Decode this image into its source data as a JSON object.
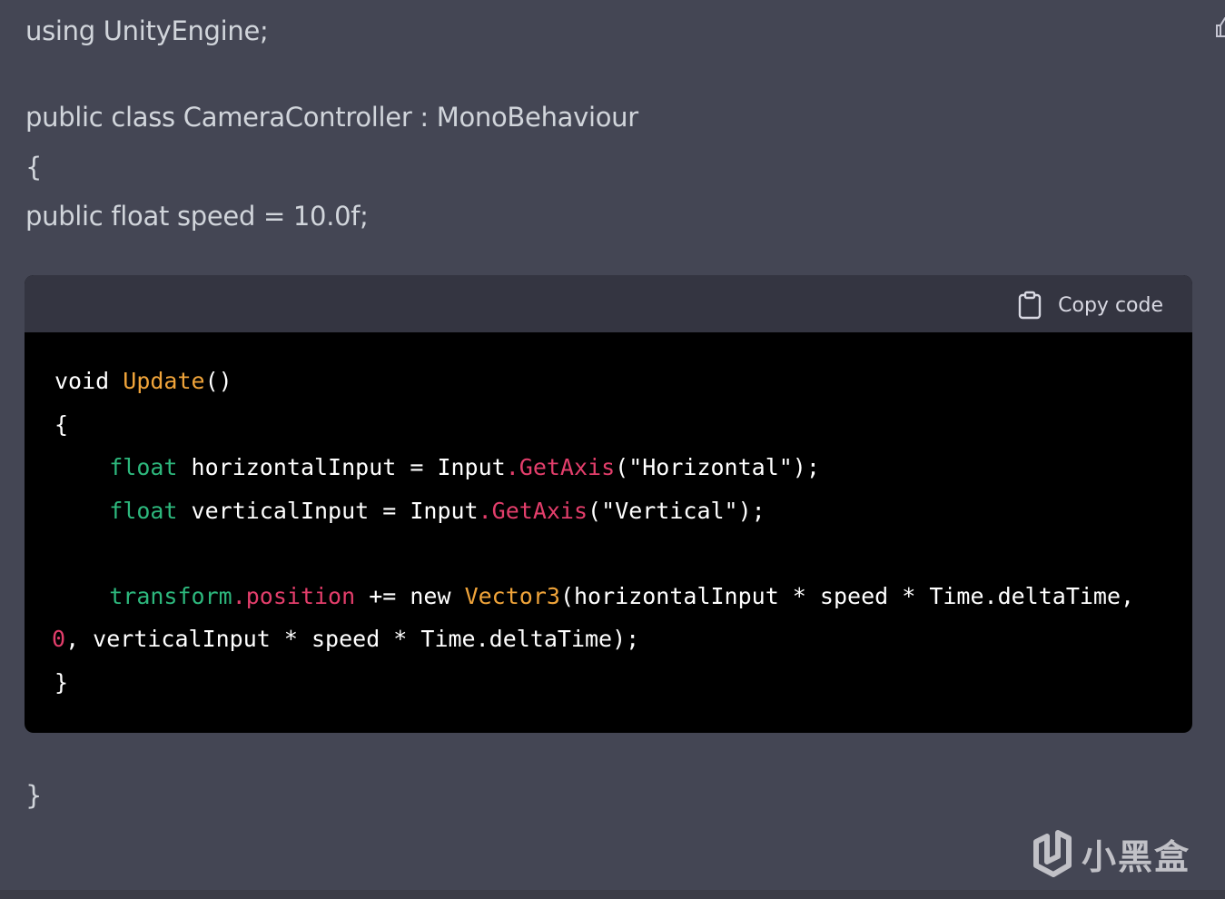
{
  "prose": {
    "line1": "using UnityEngine;",
    "line2": "public class CameraController : MonoBehaviour",
    "line3": "{",
    "line4": "public float speed = 10.0f;",
    "line5": "}"
  },
  "code_block": {
    "copy_label": "Copy code",
    "lines": {
      "l1": {
        "a": "void ",
        "b": "Update",
        "c": "()"
      },
      "l2": {
        "a": "{"
      },
      "l3": {
        "a": "    ",
        "b": "float",
        "c": " horizontalInput = Input",
        "d": ".GetAxis",
        "e": "(\"Horizontal\");"
      },
      "l4": {
        "a": "    ",
        "b": "float",
        "c": " verticalInput = Input",
        "d": ".GetAxis",
        "e": "(\"Vertical\");"
      },
      "l5": {
        "a": "    ",
        "b": "transform",
        "c": ".position",
        "d": " += new ",
        "e": "Vector3",
        "f": "(horizontalInput * speed * Time.deltaTime,"
      },
      "l6": {
        "a": "0",
        "b": ", verticalInput * speed * Time.deltaTime);"
      },
      "l7": {
        "a": "}"
      }
    }
  },
  "watermark": {
    "text": "小黑盒"
  },
  "colors": {
    "background": "#444654",
    "code_header": "#343541",
    "code_body": "#000000",
    "function": "#f0a43a",
    "type": "#2db87d",
    "literal": "#e33e6b"
  },
  "icons": {
    "copy": "clipboard-icon",
    "thumb": "thumbs-up-icon",
    "watermark": "xiaoheihe-logo-icon"
  }
}
